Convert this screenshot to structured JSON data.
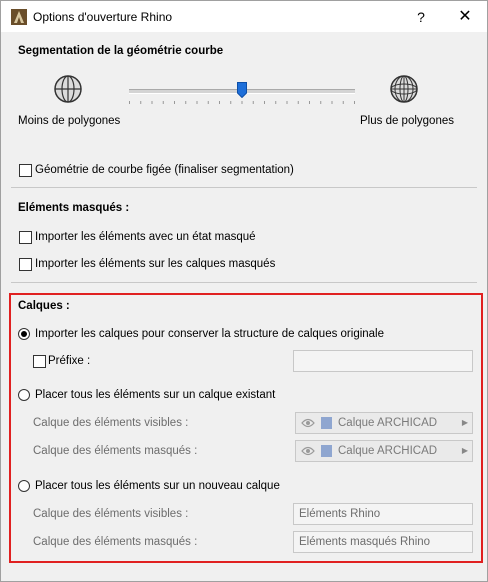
{
  "window": {
    "title": "Options d'ouverture Rhino",
    "help_label": "?",
    "close_label": "✕"
  },
  "segmentation": {
    "title": "Segmentation de la géométrie courbe",
    "min_label": "Moins de polygones",
    "max_label": "Plus de polygones",
    "slider_level": 0.5,
    "frozen_label": "Géométrie de courbe figée (finaliser segmentation)",
    "frozen_checked": false
  },
  "hidden": {
    "title": "Eléments masqués :",
    "import_hidden_state_label": "Importer les éléments avec un état masqué",
    "import_hidden_state_checked": false,
    "import_hidden_layers_label": "Importer les éléments sur les calques masqués",
    "import_hidden_layers_checked": false
  },
  "layers": {
    "title": "Calques :",
    "option1_label": "Importer les calques pour conserver la structure de calques originale",
    "option1_selected": true,
    "prefix_label": "Préfixe :",
    "prefix_checked": false,
    "prefix_value": "",
    "option2_label": "Placer tous les éléments sur un calque existant",
    "option2_selected": false,
    "existing_visible_label": "Calque des éléments visibles :",
    "existing_visible_value": "Calque ARCHICAD",
    "existing_hidden_label": "Calque des éléments masqués :",
    "existing_hidden_value": "Calque ARCHICAD",
    "option3_label": "Placer tous les éléments sur un nouveau calque",
    "option3_selected": false,
    "new_visible_label": "Calque des éléments visibles :",
    "new_visible_value": "Eléments Rhino",
    "new_hidden_label": "Calque des éléments masqués :",
    "new_hidden_value": "Eléments masqués Rhino"
  },
  "colors": {
    "highlight_border": "#e02020",
    "slider_thumb": "#1e6fd9"
  }
}
